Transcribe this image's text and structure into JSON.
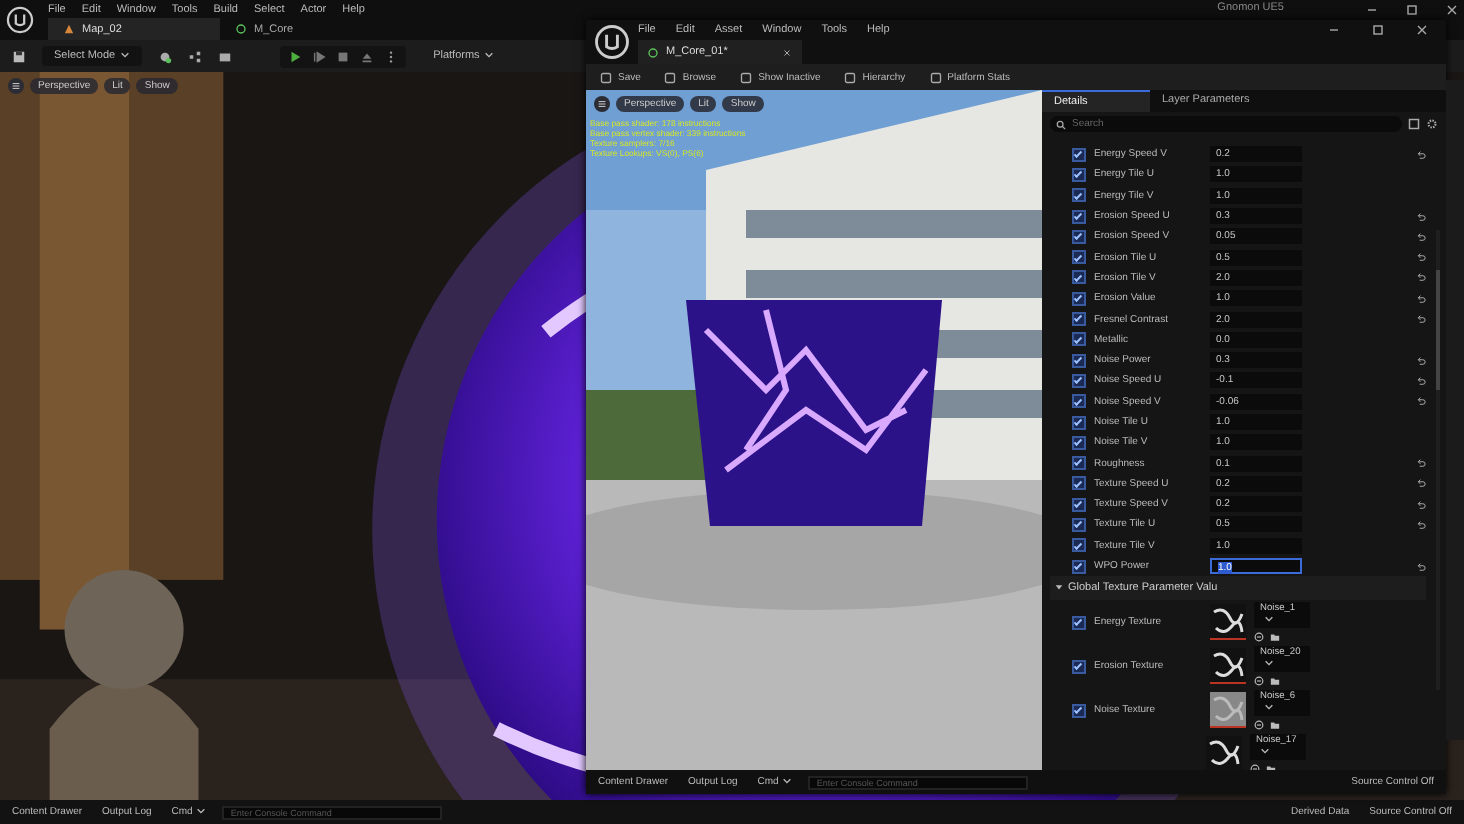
{
  "main_editor": {
    "title": "Gnomon UE5",
    "menu": [
      "File",
      "Edit",
      "Window",
      "Tools",
      "Build",
      "Select",
      "Actor",
      "Help"
    ],
    "tabs": [
      {
        "label": "Map_02",
        "selected": true
      },
      {
        "label": "M_Core",
        "selected": false
      }
    ],
    "toolbar": {
      "mode": "Select Mode",
      "platforms": "Platforms"
    },
    "viewport_toolbar": [
      "Perspective",
      "Lit",
      "Show"
    ],
    "bottom_bar": {
      "content_drawer": "Content Drawer",
      "output_log": "Output Log",
      "cmd": "Cmd",
      "console_placeholder": "Enter Console Command",
      "derived_data": "Derived Data",
      "source_control": "Source Control Off"
    }
  },
  "material_editor": {
    "menu": [
      "File",
      "Edit",
      "Asset",
      "Window",
      "Tools",
      "Help"
    ],
    "tab": "M_Core_01*",
    "toolbar": [
      "Save",
      "Browse",
      "Show Inactive",
      "Hierarchy",
      "Platform Stats"
    ],
    "viewport_toolbar": [
      "Perspective",
      "Lit",
      "Show"
    ],
    "stats": [
      "Base pass shader: 178 instructions",
      "Base pass vertex shader: 339 instructions",
      "Texture samplers: 7/16",
      "Texture Lookups: VS(0), PS(6)"
    ],
    "details_tabs": [
      {
        "label": "Details",
        "selected": true
      },
      {
        "label": "Layer Parameters",
        "selected": false
      }
    ],
    "search": {
      "placeholder": "Search"
    },
    "parameters": [
      {
        "name": "Energy Speed V",
        "value": "0.2",
        "checked": true,
        "reset": true,
        "selected": false
      },
      {
        "name": "Energy Tile U",
        "value": "1.0",
        "checked": true,
        "reset": false,
        "selected": false
      },
      {
        "name": "Energy Tile V",
        "value": "1.0",
        "checked": true,
        "reset": false,
        "selected": false
      },
      {
        "name": "Erosion Speed U",
        "value": "0.3",
        "checked": true,
        "reset": true,
        "selected": false
      },
      {
        "name": "Erosion Speed V",
        "value": "0.05",
        "checked": true,
        "reset": true,
        "selected": false
      },
      {
        "name": "Erosion Tile U",
        "value": "0.5",
        "checked": true,
        "reset": true,
        "selected": false
      },
      {
        "name": "Erosion Tile V",
        "value": "2.0",
        "checked": true,
        "reset": true,
        "selected": false
      },
      {
        "name": "Erosion Value",
        "value": "1.0",
        "checked": true,
        "reset": true,
        "selected": false
      },
      {
        "name": "Fresnel Contrast",
        "value": "2.0",
        "checked": true,
        "reset": true,
        "selected": false
      },
      {
        "name": "Metallic",
        "value": "0.0",
        "checked": true,
        "reset": false,
        "selected": false
      },
      {
        "name": "Noise Power",
        "value": "0.3",
        "checked": true,
        "reset": true,
        "selected": false
      },
      {
        "name": "Noise Speed U",
        "value": "-0.1",
        "checked": true,
        "reset": true,
        "selected": false
      },
      {
        "name": "Noise Speed V",
        "value": "-0.06",
        "checked": true,
        "reset": true,
        "selected": false
      },
      {
        "name": "Noise Tile U",
        "value": "1.0",
        "checked": true,
        "reset": false,
        "selected": false
      },
      {
        "name": "Noise Tile V",
        "value": "1.0",
        "checked": true,
        "reset": false,
        "selected": false
      },
      {
        "name": "Roughness",
        "value": "0.1",
        "checked": true,
        "reset": true,
        "selected": false
      },
      {
        "name": "Texture Speed U",
        "value": "0.2",
        "checked": true,
        "reset": true,
        "selected": false
      },
      {
        "name": "Texture Speed V",
        "value": "0.2",
        "checked": true,
        "reset": true,
        "selected": false
      },
      {
        "name": "Texture Tile U",
        "value": "0.5",
        "checked": true,
        "reset": true,
        "selected": false
      },
      {
        "name": "Texture Tile V",
        "value": "1.0",
        "checked": true,
        "reset": false,
        "selected": false
      },
      {
        "name": "WPO Power",
        "value": "1.0",
        "checked": true,
        "reset": true,
        "selected": true
      }
    ],
    "texture_section": {
      "label": "Global Texture Parameter Valu",
      "expanded": true
    },
    "textures": [
      {
        "name": "Energy Texture",
        "value": "Noise_1",
        "checked": true
      },
      {
        "name": "Erosion Texture",
        "value": "Noise_20",
        "checked": true
      },
      {
        "name": "Noise Texture",
        "value": "Noise_6",
        "checked": true
      },
      {
        "value": "Noise_17"
      }
    ],
    "bottom_bar": {
      "content_drawer": "Content Drawer",
      "output_log": "Output Log",
      "cmd": "Cmd",
      "console_placeholder": "Enter Console Command",
      "source_control": "Source Control Off"
    }
  }
}
